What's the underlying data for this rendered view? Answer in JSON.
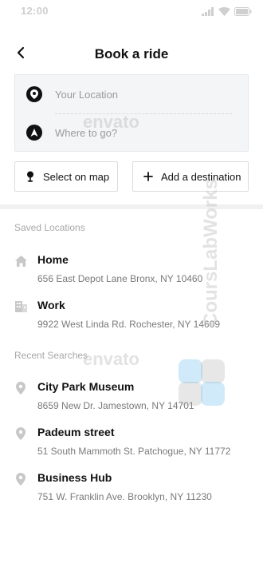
{
  "status_bar": {
    "time": "12:00"
  },
  "header": {
    "title": "Book a ride"
  },
  "route": {
    "from_placeholder": "Your Location",
    "to_placeholder": "Where to go?"
  },
  "actions": {
    "map_label": "Select on map",
    "destination_label": "Add a destination"
  },
  "saved": {
    "heading": "Saved Locations",
    "items": [
      {
        "name": "Home",
        "address": "656 East Depot Lane Bronx, NY 10460",
        "icon": "home-icon"
      },
      {
        "name": "Work",
        "address": "9922 West Linda Rd. Rochester, NY 14609",
        "icon": "building-icon"
      }
    ]
  },
  "recent": {
    "heading": "Recent Searches",
    "items": [
      {
        "name": "City Park Museum",
        "address": "8659 New Dr. Jamestown, NY 14701",
        "icon": "pin-icon"
      },
      {
        "name": "Padeum street",
        "address": "51 South Mammoth St. Patchogue, NY 11772",
        "icon": "pin-icon"
      },
      {
        "name": "Business Hub",
        "address": "751 W. Franklin Ave. Brooklyn, NY 11230",
        "icon": "pin-icon"
      }
    ]
  },
  "watermarks": {
    "envato": "envato",
    "brand": "CoursLabWorks"
  },
  "colors": {
    "accent": "#111111",
    "muted_text": "#9a9a9a",
    "input_bg": "#f4f5f7"
  }
}
